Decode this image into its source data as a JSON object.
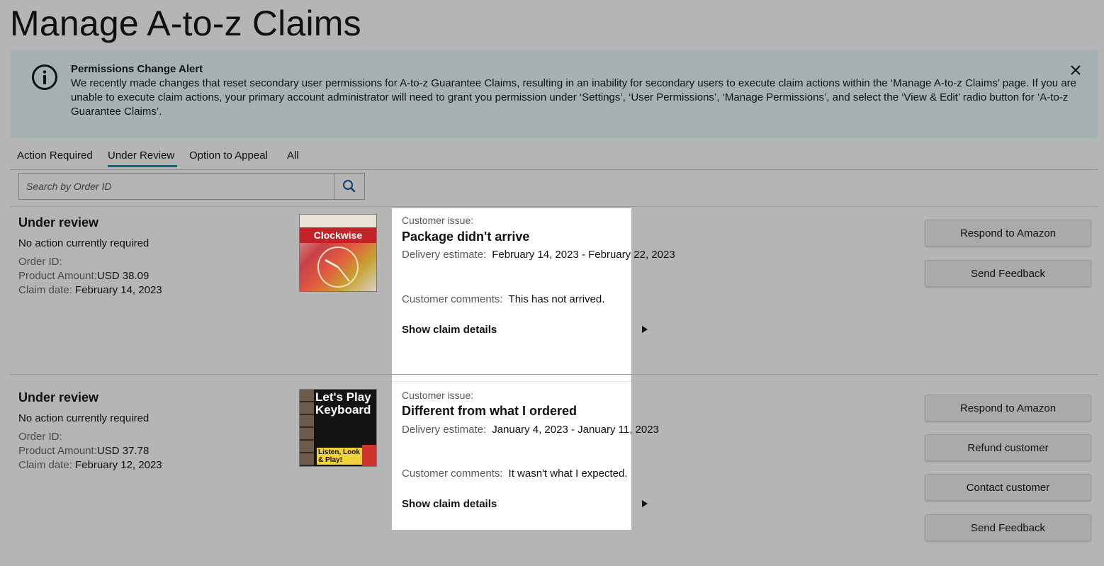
{
  "page": {
    "title": "Manage A-to-z Claims"
  },
  "alert": {
    "title": "Permissions Change Alert",
    "body": "We recently made changes that reset secondary user permissions for A-to-z Guarantee Claims, resulting in an inability for secondary users to execute claim actions within the ‘Manage A-to-z Claims’ page. If you are unable to execute claim actions, your primary account administrator will need to grant you permission under ‘Settings’, ‘User Permissions’, ‘Manage Permissions’, and select the ‘View & Edit’ radio button for ‘A-to-z Guarantee Claims’.",
    "icon": "info-icon",
    "close_icon": "close-icon"
  },
  "tabs": [
    {
      "label": "Action Required"
    },
    {
      "label": "Under Review",
      "active": true
    },
    {
      "label": "Option to Appeal"
    },
    {
      "label": "All"
    }
  ],
  "search": {
    "placeholder": "Search by Order ID",
    "icon": "search-icon"
  },
  "labels": {
    "order_id": "Order ID:",
    "product_amount": "Product Amount:",
    "claim_date": "Claim date:",
    "customer_issue": "Customer issue:",
    "delivery_estimate": "Delivery estimate:",
    "customer_comments": "Customer comments:",
    "show_claim_details": "Show claim details"
  },
  "claims": [
    {
      "status": "Under review",
      "substatus": "No action currently required",
      "product_amount": "USD 38.09",
      "claim_date": "February 14, 2023",
      "thumb_title": "Clockwise",
      "issue": "Package didn't arrive",
      "delivery_estimate": "February 14, 2023 - February 22, 2023",
      "comments": "This has not arrived.",
      "actions": [
        "Respond to Amazon",
        "Send Feedback"
      ]
    },
    {
      "status": "Under review",
      "substatus": "No action currently required",
      "product_amount": "USD 37.78",
      "claim_date": "February 12, 2023",
      "thumb_title": "Let's Play Keyboard",
      "thumb_footer": "Listen, Look & Play!",
      "issue": "Different from what I ordered",
      "delivery_estimate": "January 4, 2023 - January 11, 2023",
      "comments": "It wasn't what I expected.",
      "actions": [
        "Respond to Amazon",
        "Refund customer",
        "Contact customer",
        "Send Feedback"
      ]
    }
  ]
}
